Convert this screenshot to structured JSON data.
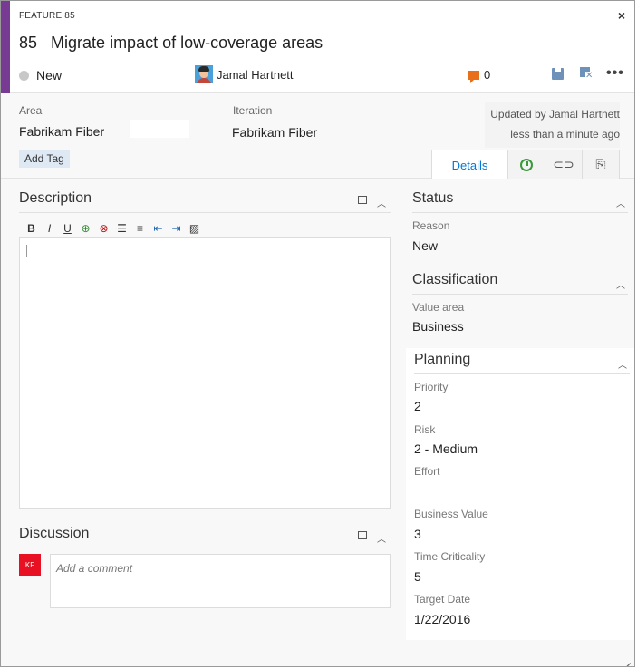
{
  "header": {
    "type_label": "FEATURE 85",
    "close_glyph": "×",
    "work_item_id": "85",
    "title": "Migrate impact of low-coverage areas",
    "state": "New",
    "assignee": "Jamal Hartnett",
    "comment_count": "0",
    "more_glyph": "•••",
    "accent_color": "#773b93"
  },
  "fields": {
    "area_label": "Area",
    "area_value": "Fabrikam Fiber",
    "iteration_label": "Iteration",
    "iteration_value": "Fabrikam Fiber",
    "updated_by": "Updated by Jamal Hartnett",
    "updated_when": "less than a minute ago",
    "add_tag": "Add Tag"
  },
  "tabs": {
    "details": "Details",
    "history_icon": "history-icon",
    "links_icon": "link-icon",
    "attachments_icon": "paperclip-icon"
  },
  "description": {
    "title": "Description",
    "toolbar": {
      "bold": "B",
      "italic": "I",
      "underline": "U"
    }
  },
  "discussion": {
    "title": "Discussion",
    "avatar_initials": "KF",
    "placeholder": "Add a comment"
  },
  "status": {
    "title": "Status",
    "reason_label": "Reason",
    "reason_value": "New"
  },
  "classification": {
    "title": "Classification",
    "value_area_label": "Value area",
    "value_area_value": "Business"
  },
  "planning": {
    "title": "Planning",
    "priority_label": "Priority",
    "priority_value": "2",
    "risk_label": "Risk",
    "risk_value": "2 - Medium",
    "effort_label": "Effort",
    "effort_value": "",
    "business_value_label": "Business Value",
    "business_value_value": "3",
    "time_criticality_label": "Time Criticality",
    "time_criticality_value": "5",
    "target_date_label": "Target Date",
    "target_date_value": "1/22/2016"
  }
}
